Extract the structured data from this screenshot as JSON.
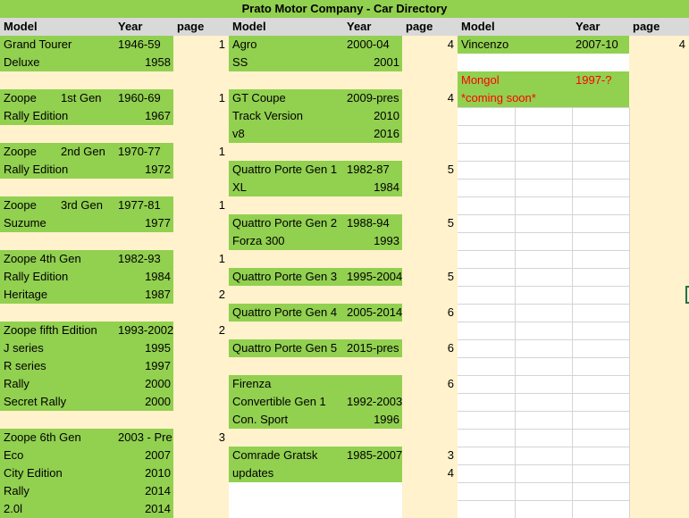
{
  "title": "Prato Motor Company - Car Directory",
  "headers": {
    "model": "Model",
    "year": "Year",
    "page": "page"
  },
  "col1": [
    {
      "row": 0,
      "model": "Grand Tourer",
      "year": "1946-59",
      "page": "1"
    },
    {
      "row": 1,
      "model": "Deluxe",
      "year": "1958",
      "page": ""
    },
    {
      "row": 3,
      "model": "Zoope",
      "gen": "1st Gen",
      "year": "1960-69",
      "page": "1"
    },
    {
      "row": 4,
      "model": "Rally Edition",
      "year": "1967",
      "page": ""
    },
    {
      "row": 6,
      "model": "Zoope",
      "gen": "2nd Gen",
      "year": "1970-77",
      "page": "1"
    },
    {
      "row": 7,
      "model": "Rally Edition",
      "year": "1972",
      "page": ""
    },
    {
      "row": 9,
      "model": "Zoope",
      "gen": "3rd Gen",
      "year": "1977-81",
      "page": "1"
    },
    {
      "row": 10,
      "model": "Suzume",
      "year": "1977",
      "page": ""
    },
    {
      "row": 12,
      "model": "Zoope 4th Gen",
      "year": "1982-93",
      "page": "1"
    },
    {
      "row": 13,
      "model": "Rally Edition",
      "year": "1984",
      "page": ""
    },
    {
      "row": 14,
      "model": "Heritage",
      "year": "1987",
      "page": "2"
    },
    {
      "row": 16,
      "model": "Zoope fifth Edition",
      "year": "1993-2002",
      "page": "2"
    },
    {
      "row": 17,
      "model": "J series",
      "year": "1995",
      "page": ""
    },
    {
      "row": 18,
      "model": "R series",
      "year": "1997",
      "page": ""
    },
    {
      "row": 19,
      "model": "Rally",
      "year": "2000",
      "page": ""
    },
    {
      "row": 20,
      "model": "Secret Rally",
      "year": "2000",
      "page": ""
    },
    {
      "row": 22,
      "model": "Zoope 6th Gen",
      "year": "2003 - Pre",
      "page": "3"
    },
    {
      "row": 23,
      "model": "Eco",
      "year": "2007",
      "page": ""
    },
    {
      "row": 24,
      "model": "City Edition",
      "year": "2010",
      "page": ""
    },
    {
      "row": 25,
      "model": "Rally",
      "year": "2014",
      "page": ""
    },
    {
      "row": 26,
      "model": "2.0l",
      "year": "2014",
      "page": ""
    }
  ],
  "col2": [
    {
      "row": 0,
      "model": "Agro",
      "year": "2000-04",
      "page": "4"
    },
    {
      "row": 1,
      "model": "SS",
      "year": "2001",
      "page": ""
    },
    {
      "row": 3,
      "model": "GT Coupe",
      "year": "2009-pres",
      "page": "4"
    },
    {
      "row": 4,
      "model": "Track Version",
      "year": "2010",
      "page": ""
    },
    {
      "row": 5,
      "model": "v8",
      "year": "2016",
      "page": ""
    },
    {
      "row": 7,
      "model": "Quattro Porte Gen 1",
      "year": "1982-87",
      "page": "5"
    },
    {
      "row": 8,
      "model": "XL",
      "year": "1984",
      "page": ""
    },
    {
      "row": 10,
      "model": "Quattro Porte Gen 2",
      "year": "1988-94",
      "page": "5"
    },
    {
      "row": 11,
      "model": "Forza 300",
      "year": "1993",
      "page": ""
    },
    {
      "row": 13,
      "model": "Quattro Porte Gen 3",
      "year": "1995-2004",
      "page": "5"
    },
    {
      "row": 15,
      "model": "Quattro Porte Gen 4",
      "year": "2005-2014",
      "page": "6"
    },
    {
      "row": 17,
      "model": "Quattro Porte Gen 5",
      "year": "2015-pres",
      "page": "6"
    },
    {
      "row": 19,
      "model": "Firenza",
      "year": "",
      "page": "6"
    },
    {
      "row": 20,
      "model": "Convertible Gen 1",
      "year": "1992-2003",
      "page": ""
    },
    {
      "row": 21,
      "model": "Con. Sport",
      "year": "1996",
      "page": ""
    },
    {
      "row": 23,
      "model": "Comrade Gratsk",
      "year": "1985-2007",
      "page": "3"
    },
    {
      "row": 24,
      "model": "updates",
      "year": "",
      "page": "4"
    }
  ],
  "col3": [
    {
      "row": 0,
      "model": "Vincenzo",
      "year": "2007-10",
      "page": "4"
    },
    {
      "row": 2,
      "model": "Mongol",
      "year": "1997-?",
      "page": "",
      "red": true
    },
    {
      "row": 3,
      "model": "*coming soon*",
      "year": "",
      "page": "",
      "red": true
    }
  ],
  "colors": {
    "green": "#92d050",
    "cream": "#fff2cc",
    "header_gray": "#d9d9d9",
    "red": "#ff0000"
  }
}
